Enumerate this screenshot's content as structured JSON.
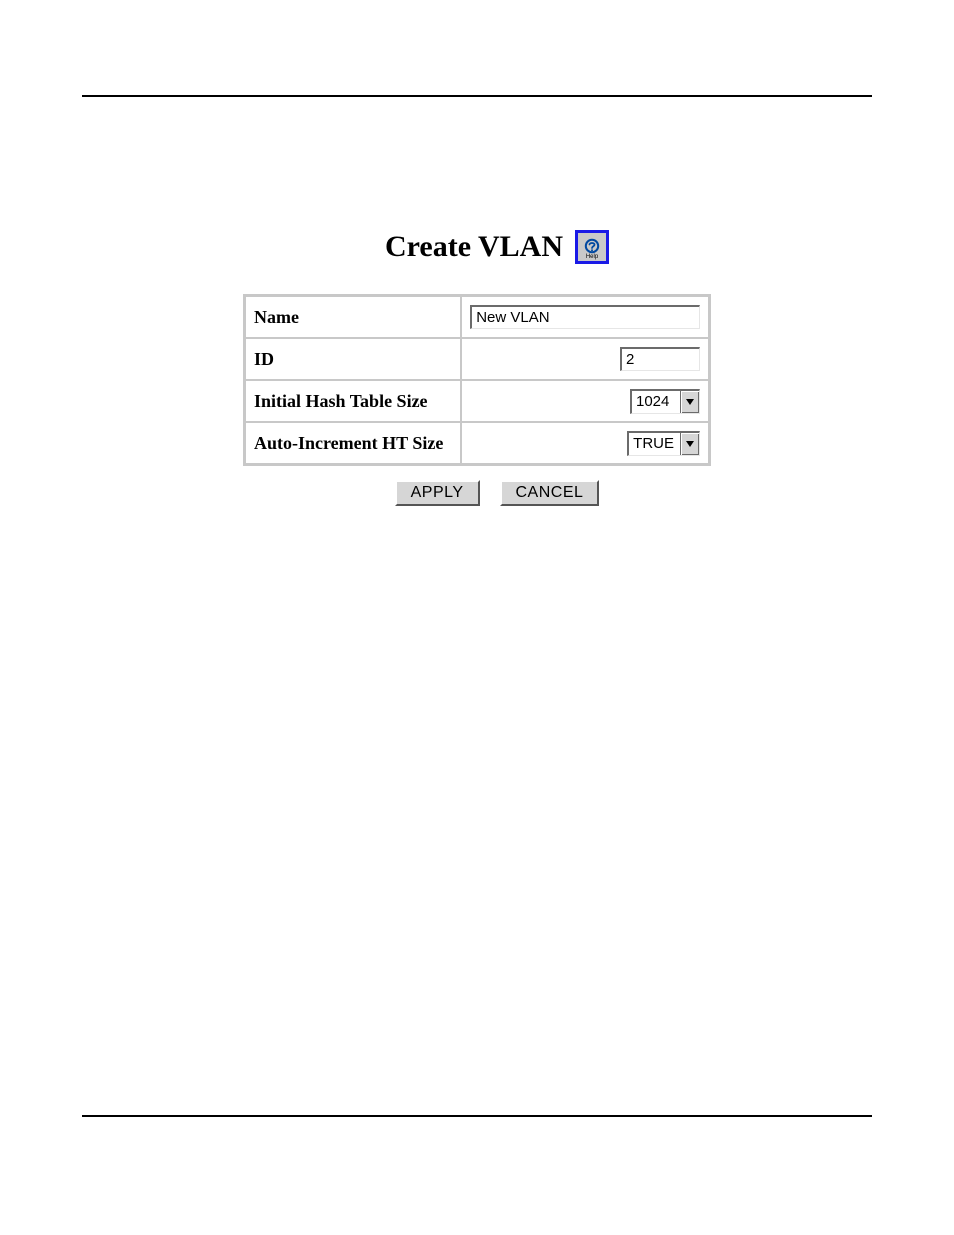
{
  "header": {
    "title": "Create VLAN",
    "help_label": "Help"
  },
  "form": {
    "rows": [
      {
        "label": "Name"
      },
      {
        "label": "ID"
      },
      {
        "label": "Initial Hash Table Size"
      },
      {
        "label": "Auto-Increment HT Size"
      }
    ],
    "name_value": "New VLAN",
    "id_value": "2",
    "hash_size_value": "1024",
    "auto_inc_value": "TRUE"
  },
  "buttons": {
    "apply": "APPLY",
    "cancel": "CANCEL"
  }
}
